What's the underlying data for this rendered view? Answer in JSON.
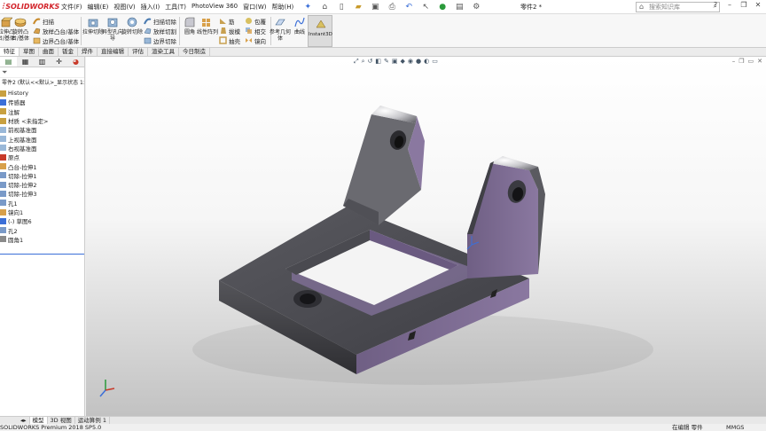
{
  "app": {
    "logo_text": "SOLIDWORKS",
    "doc_title": "零件2 *",
    "search_placeholder": "搜索知识库"
  },
  "menu": [
    "文件(F)",
    "编辑(E)",
    "视图(V)",
    "插入(I)",
    "工具(T)",
    "PhotoView 360",
    "窗口(W)",
    "帮助(H)"
  ],
  "ribbon": {
    "extrude_boss": "拉伸凸台/基体",
    "revolve_boss": "旋转凸台/基体",
    "sweep": "扫描",
    "loft": "放样凸台/基体",
    "boundary": "边界凸台/基体",
    "extrude_cut": "拉伸切除",
    "hole_wizard": "异型孔向导",
    "revolve_cut": "旋转切除",
    "swept_cut": "扫描切除",
    "lofted_cut": "放样切割",
    "boundary_cut": "边界切除",
    "fillet": "圆角",
    "linear_pattern": "线性阵列",
    "rib": "筋",
    "draft": "拔模",
    "shell": "抽壳",
    "wrap": "包覆",
    "intersect": "相交",
    "mirror": "镜向",
    "ref_geometry": "参考几何体",
    "curves": "曲线",
    "instant3d": "Instant3D"
  },
  "tabs": [
    "特征",
    "草图",
    "曲面",
    "钣金",
    "焊件",
    "直接编辑",
    "评估",
    "渲染工具",
    "今日制造"
  ],
  "active_tab": "特征",
  "tree": {
    "root": "零件2 (默认<<默认>_显示状态 1>)",
    "items": [
      {
        "label": "History",
        "icon": "history-icon"
      },
      {
        "label": "传感器",
        "icon": "sensor-icon"
      },
      {
        "label": "注解",
        "icon": "annotation-icon"
      },
      {
        "label": "材质 <未指定>",
        "icon": "material-icon"
      },
      {
        "label": "前视基准面",
        "icon": "plane-icon"
      },
      {
        "label": "上视基准面",
        "icon": "plane-icon"
      },
      {
        "label": "右视基准面",
        "icon": "plane-icon"
      },
      {
        "label": "原点",
        "icon": "origin-icon"
      },
      {
        "label": "凸台-拉伸1",
        "icon": "extrude-icon"
      },
      {
        "label": "切除-拉伸1",
        "icon": "cut-icon"
      },
      {
        "label": "切除-拉伸2",
        "icon": "cut-icon"
      },
      {
        "label": "切除-拉伸3",
        "icon": "cut-icon"
      },
      {
        "label": "孔1",
        "icon": "hole-icon"
      },
      {
        "label": "镜向1",
        "icon": "mirror-icon"
      },
      {
        "label": "(-) 草图6",
        "icon": "sketch-icon"
      },
      {
        "label": "孔2",
        "icon": "hole-icon"
      },
      {
        "label": "圆角1",
        "icon": "fillet-icon"
      }
    ]
  },
  "bottom_tabs": [
    "模型",
    "3D 视图",
    "运动算例 1"
  ],
  "status": {
    "left": "SOLIDWORKS Premium 2018 SP5.0",
    "mode": "在编辑 零件",
    "units": "MMGS"
  },
  "colors": {
    "model_face": "#7a6a8e",
    "model_dark": "#4a4a50",
    "accent_red": "#d2232a"
  }
}
